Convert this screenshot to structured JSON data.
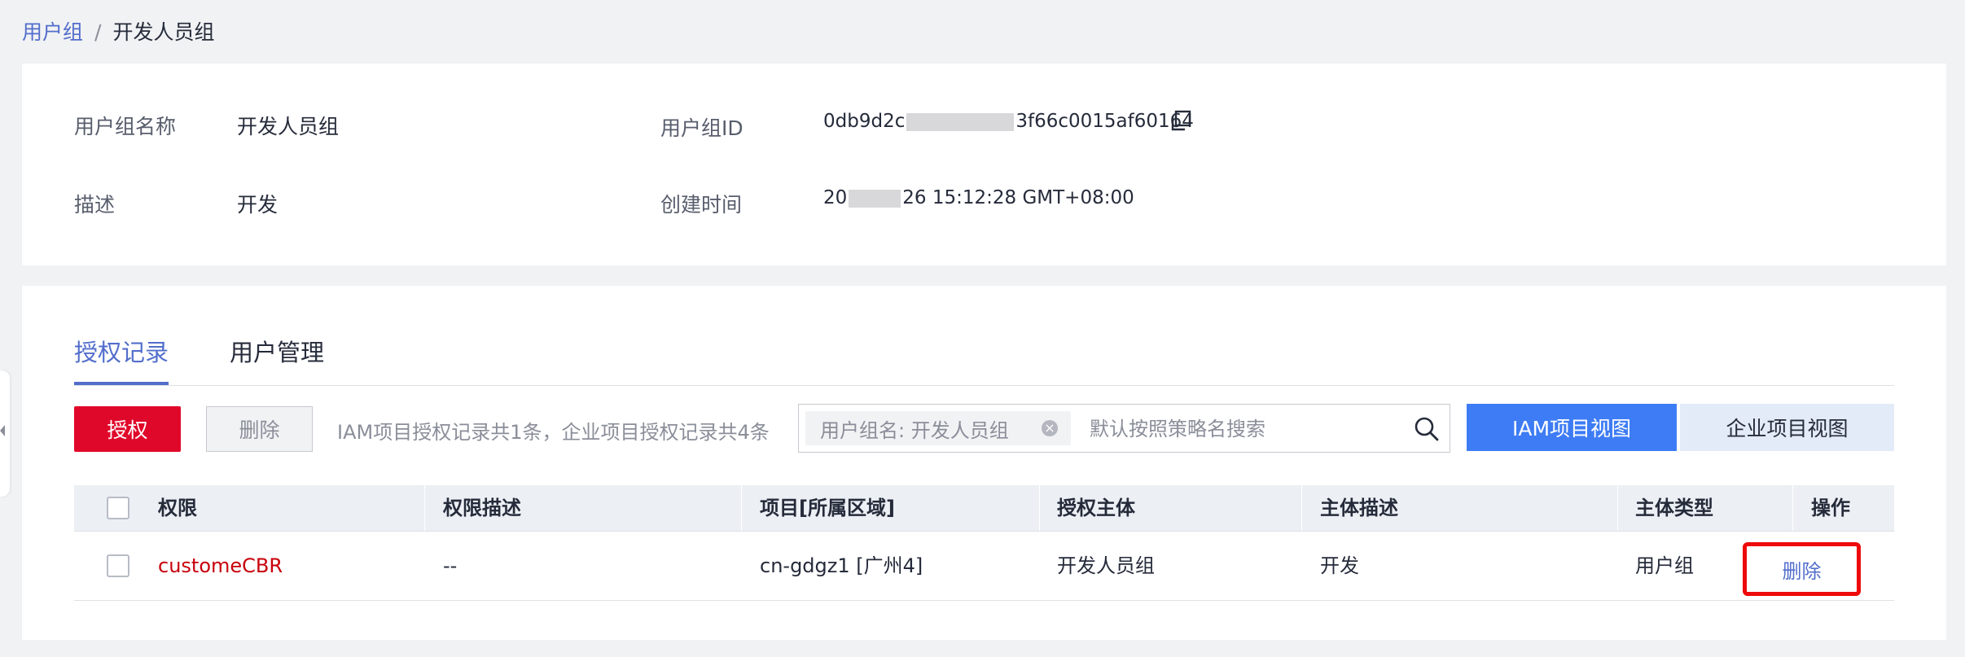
{
  "breadcrumb": {
    "parent": "用户组",
    "separator": "/",
    "current": "开发人员组"
  },
  "info": {
    "name_label": "用户组名称",
    "name_value": "开发人员组",
    "desc_label": "描述",
    "desc_value": "开发",
    "id_label": "用户组ID",
    "id_prefix": "0db9d2c",
    "id_suffix": "3f66c0015af60164",
    "created_label": "创建时间",
    "created_prefix": "20",
    "created_suffix": "26 15:12:28 GMT+08:00"
  },
  "tabs": [
    {
      "label": "授权记录",
      "active": true
    },
    {
      "label": "用户管理",
      "active": false
    }
  ],
  "toolbar": {
    "auth_label": "授权",
    "delete_label": "删除",
    "count_text": "IAM项目授权记录共1条，企业项目授权记录共4条",
    "search_chip": "用户组名: 开发人员组",
    "search_placeholder": "默认按照策略名搜索",
    "view_iam": "IAM项目视图",
    "view_enterprise": "企业项目视图"
  },
  "table": {
    "headers": [
      "权限",
      "权限描述",
      "项目[所属区域]",
      "授权主体",
      "主体描述",
      "主体类型",
      "操作"
    ],
    "rows": [
      {
        "permission": "customeCBR",
        "description": "--",
        "project": "cn-gdgz1 [广州4]",
        "principal": "开发人员组",
        "principal_desc": "开发",
        "principal_type": "用户组",
        "action": "删除"
      }
    ]
  },
  "colors": {
    "accent": "#526ecc",
    "primary_button": "#e0082a",
    "view_active": "#3e7cf5",
    "highlight_box": "#ee0a0a"
  }
}
